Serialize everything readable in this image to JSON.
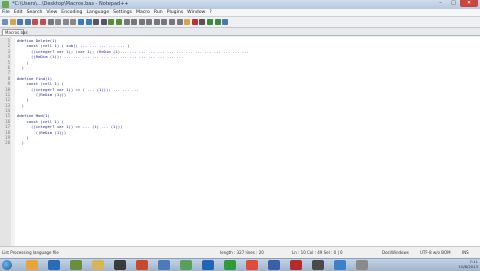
{
  "window": {
    "title": "*C:\\Users\\...\\Desktop\\Macros.bas - Notepad++",
    "minimize_label": "–",
    "maximize_label": "□",
    "close_label": "✕"
  },
  "menu": [
    "File",
    "Edit",
    "Search",
    "View",
    "Encoding",
    "Language",
    "Settings",
    "Macro",
    "Run",
    "Plugins",
    "Window",
    "?"
  ],
  "toolbar_icons": [
    "new-file-icon",
    "open-file-icon",
    "save-icon",
    "save-all-icon",
    "close-icon",
    "close-all-icon",
    "print-icon",
    "cut-icon",
    "copy-icon",
    "paste-icon",
    "undo-icon",
    "redo-icon",
    "find-icon",
    "replace-icon",
    "zoom-in-icon",
    "zoom-out-icon",
    "sync-v-icon",
    "sync-h-icon",
    "wrap-icon",
    "show-all-icon",
    "indent-guide-icon",
    "udl-icon",
    "doc-map-icon",
    "function-list-icon",
    "folder-icon",
    "macro-record-icon",
    "macro-stop-icon",
    "macro-play-icon",
    "macro-run-icon",
    "macro-save-icon"
  ],
  "tab": {
    "label": "Macros.bas"
  },
  "lines": [
    {
      "n": "1",
      "text": "#define Delete(1)"
    },
    {
      "n": "2",
      "text": "    const (cell 1) ( sub(( ... ... ... ... ... )"
    },
    {
      "n": "3",
      "text": "      ((integer? var 1); (var 1); (ReDim (1)... ... ... ... ... ... ... ... ... ... ... ... ... ..."
    },
    {
      "n": "4",
      "text": "      ((ReDim (1)); ... ... ... ... ... ... ... ... ... ... ... ... ..."
    },
    {
      "n": "5",
      "text": "    )"
    },
    {
      "n": "6",
      "text": "  )"
    },
    {
      "n": "7",
      "text": ""
    },
    {
      "n": "8",
      "text": "#define Find(1)"
    },
    {
      "n": "9",
      "text": "    const (cell 1) ("
    },
    {
      "n": "10",
      "text": "      ((integer? var 1)) => ( ... (1))); ... ... ..."
    },
    {
      "n": "11",
      "text": "        ((ReDim (1)))"
    },
    {
      "n": "12",
      "text": "    )"
    },
    {
      "n": "13",
      "text": "  )"
    },
    {
      "n": "14",
      "text": ""
    },
    {
      "n": "15",
      "text": "#define Mod(1)"
    },
    {
      "n": "16",
      "text": "    const (cell 1) ("
    },
    {
      "n": "17",
      "text": "      ((integer? var 1)) => ... (1) ... (1)))"
    },
    {
      "n": "18",
      "text": "        ((ReDim (1)))"
    },
    {
      "n": "19",
      "text": "    )"
    },
    {
      "n": "20",
      "text": "  )"
    }
  ],
  "status": {
    "lang": "List Processing language file",
    "length": "length : 327   lines : 20",
    "pos": "Ln : 10   Col : 49   Sel : 0 | 0",
    "eol": "Dos\\Windows",
    "enc": "UTF-8 w/o BOM",
    "ins": "INS"
  },
  "taskbar": {
    "time": "7:11",
    "date": "10/8/2013"
  },
  "colors": {
    "start": "#1c5a9c"
  }
}
